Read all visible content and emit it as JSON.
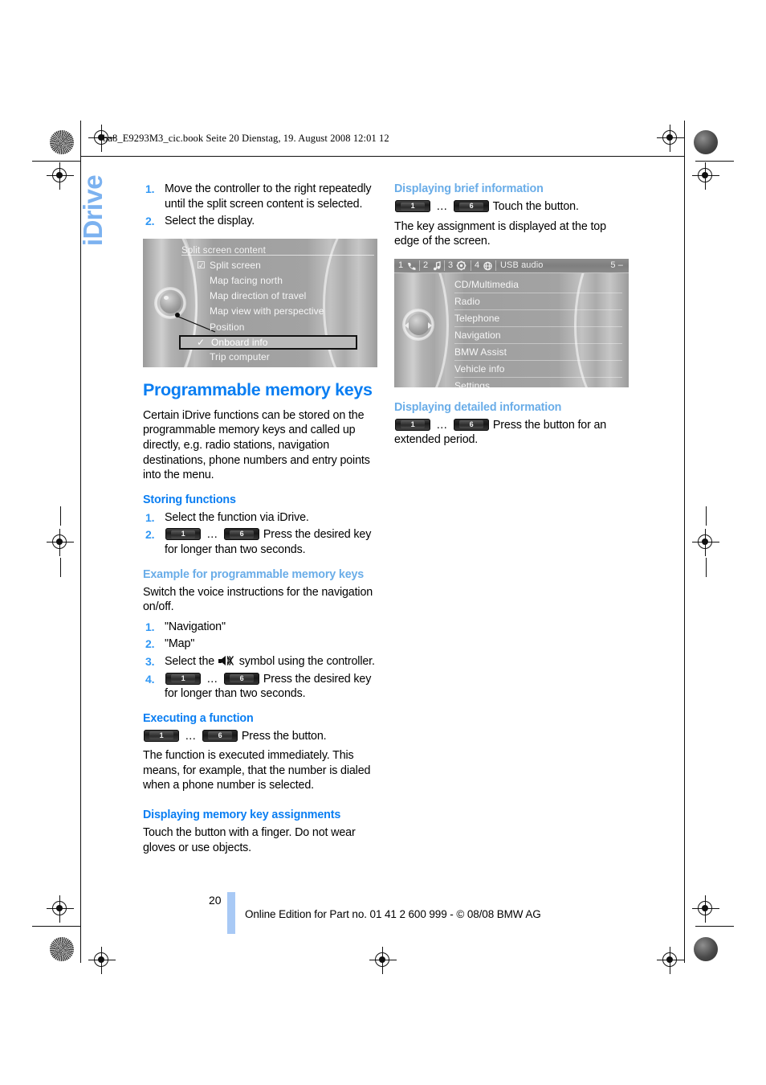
{
  "meta": {
    "running_header": "ba8_E9293M3_cic.book  Seite 20  Dienstag, 19. August 2008  12:01 12",
    "section_tab": "iDrive",
    "page_number": "20",
    "footer": "Online Edition for Part no. 01 41 2 600 999 - © 08/08 BMW AG",
    "accent_blue": "#0a7ef2",
    "light_blue": "#6aade8",
    "tab_blue": "#7cb2f0",
    "number_blue": "#2f97f5"
  },
  "left_column": {
    "intro_steps": [
      {
        "num": "1.",
        "text": "Move the controller to the right repeatedly until the split screen content is selected."
      },
      {
        "num": "2.",
        "text": "Select the display."
      }
    ],
    "screenshot_split": {
      "title": "Split screen content",
      "items": [
        {
          "label": "Split screen",
          "check": "☑",
          "selected": false
        },
        {
          "label": "Map facing north",
          "check": "",
          "selected": false
        },
        {
          "label": "Map direction of travel",
          "check": "",
          "selected": false
        },
        {
          "label": "Map view with perspective",
          "check": "",
          "selected": false
        },
        {
          "label": "Position",
          "check": "",
          "selected": false
        },
        {
          "label": "Onboard info",
          "check": "✓",
          "selected": true
        },
        {
          "label": "Trip computer",
          "check": "",
          "selected": false
        }
      ]
    },
    "heading_main": "Programmable memory keys",
    "intro_paragraph": "Certain iDrive functions can be stored on the programmable memory keys and called up directly, e.g. radio stations, navigation destinations, phone numbers and entry points into the menu.",
    "storing": {
      "heading": "Storing functions",
      "steps": [
        {
          "num": "1.",
          "text": "Select the function via iDrive.",
          "keys": false
        },
        {
          "num": "2.",
          "text": "Press the desired key for longer than two seconds.",
          "keys": true
        }
      ]
    },
    "example": {
      "heading": "Example for programmable memory keys",
      "paragraph": "Switch the voice instructions for the navigation on/off.",
      "steps": [
        {
          "num": "1.",
          "text": "\"Navigation\"",
          "keys": false,
          "mute": false
        },
        {
          "num": "2.",
          "text": "\"Map\"",
          "keys": false,
          "mute": false
        },
        {
          "num": "3.",
          "text_before": "Select the",
          "text_after": "symbol using the controller.",
          "keys": false,
          "mute": true
        },
        {
          "num": "4.",
          "text": "Press the desired key for longer than two seconds.",
          "keys": true,
          "mute": false
        }
      ]
    },
    "executing": {
      "heading": "Executing a function",
      "key_line_text": "Press the button.",
      "paragraph": "The function is executed immediately. This means, for example, that the number is dialed when a phone number is selected."
    },
    "assignments": {
      "heading": "Displaying memory key assignments",
      "paragraph": "Touch the button with a finger. Do not wear gloves or use objects."
    }
  },
  "right_column": {
    "brief": {
      "heading": "Displaying brief information",
      "key_line_text": "Touch the button.",
      "paragraph": "The key assignment is displayed at the top edge of the screen."
    },
    "screenshot_main": {
      "status_keys": [
        {
          "num": "1",
          "icon": "phone-icon"
        },
        {
          "num": "2",
          "icon": "note-icon"
        },
        {
          "num": "3",
          "icon": "gear-icon"
        },
        {
          "num": "4",
          "icon": "globe-icon"
        }
      ],
      "status_label": "USB audio",
      "status_right": "5 –",
      "items": [
        "CD/Multimedia",
        "Radio",
        "Telephone",
        "Navigation",
        "BMW Assist",
        "Vehicle info",
        "Settings"
      ]
    },
    "detailed": {
      "heading": "Displaying detailed information",
      "key_line_text": "Press the button for an extended period."
    }
  },
  "keys": {
    "first": "1",
    "ellipsis": "...",
    "last": "6"
  }
}
